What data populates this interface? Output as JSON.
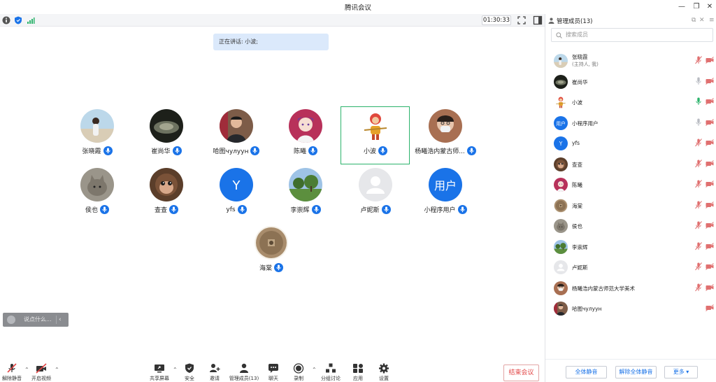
{
  "window": {
    "title": "腾讯会议",
    "minimize": "—",
    "restore": "❐",
    "close": "✕"
  },
  "status": {
    "timer": "01:30:33"
  },
  "speaking": {
    "text": "正在讲话: 小波;"
  },
  "participants": [
    {
      "name": "张晓霞",
      "avatar": "photo-beach",
      "bg": "#9fc4dc"
    },
    {
      "name": "崔尚华",
      "avatar": "photo-dark",
      "bg": "#2f3328"
    },
    {
      "name": "哈图чулуун",
      "avatar": "photo-man",
      "bg": "#8a6f5a"
    },
    {
      "name": "陈曦",
      "avatar": "anime-girl",
      "bg": "#c0406a"
    },
    {
      "name": "小波",
      "avatar": "monkey-king",
      "bg": "#ffffff"
    },
    {
      "name": "杨曦浩内蒙古师...",
      "avatar": "photo-mask",
      "bg": "#b07a5c"
    },
    {
      "name": "侯也",
      "avatar": "photo-cat",
      "bg": "#8e8a80"
    },
    {
      "name": "查查",
      "avatar": "photo-monkey",
      "bg": "#6a4a34"
    },
    {
      "name": "yfs",
      "avatar": "letter",
      "letter": "Y",
      "bg": "#1a73e8"
    },
    {
      "name": "李崇辉",
      "avatar": "photo-park",
      "bg": "#4c7d3c"
    },
    {
      "name": "卢妮斯",
      "avatar": "default",
      "bg": "#e6e7ea"
    },
    {
      "name": "小程序用户",
      "avatar": "letter",
      "letter": "用户",
      "bg": "#1a73e8"
    },
    {
      "name": "海棠",
      "avatar": "photo-coin",
      "bg": "#a88c6c"
    }
  ],
  "chat": {
    "placeholder": "说点什么..."
  },
  "toolbar": {
    "unmute": "解除静音",
    "start_video": "开启视频",
    "share": "共享屏幕",
    "security": "安全",
    "invite": "邀请",
    "manage": "管理成员(13)",
    "chat": "聊天",
    "record": "录制",
    "breakout": "分组讨论",
    "apps": "应用",
    "settings": "设置",
    "end": "结束会议"
  },
  "panel": {
    "title": "管理成员(13)",
    "search_placeholder": "搜索成员",
    "members": [
      {
        "name": "张晓霞",
        "sub": "(主持人, 我)",
        "mic": "muted"
      },
      {
        "name": "崔尚华",
        "mic": "on"
      },
      {
        "name": "小波",
        "mic": "talking"
      },
      {
        "name": "小程序用户",
        "mic": "on"
      },
      {
        "name": "yfs",
        "mic": "muted"
      },
      {
        "name": "查查",
        "mic": "muted"
      },
      {
        "name": "陈曦",
        "mic": "muted"
      },
      {
        "name": "海棠",
        "mic": "muted"
      },
      {
        "name": "侯也",
        "mic": "muted"
      },
      {
        "name": "李崇辉",
        "mic": "muted"
      },
      {
        "name": "卢妮斯",
        "mic": "muted"
      },
      {
        "name": "杨曦浩内蒙古师范大学美术",
        "mic": "muted"
      },
      {
        "name": "哈图чулуун",
        "mic": "none"
      }
    ],
    "mute_all": "全体静音",
    "unmute_all": "解除全体静音",
    "more": "更多 ▾"
  },
  "colors": {
    "accent": "#1a73e8",
    "active_speaker": "#2bb36b",
    "end": "#e24545",
    "muted": "#e07070"
  }
}
